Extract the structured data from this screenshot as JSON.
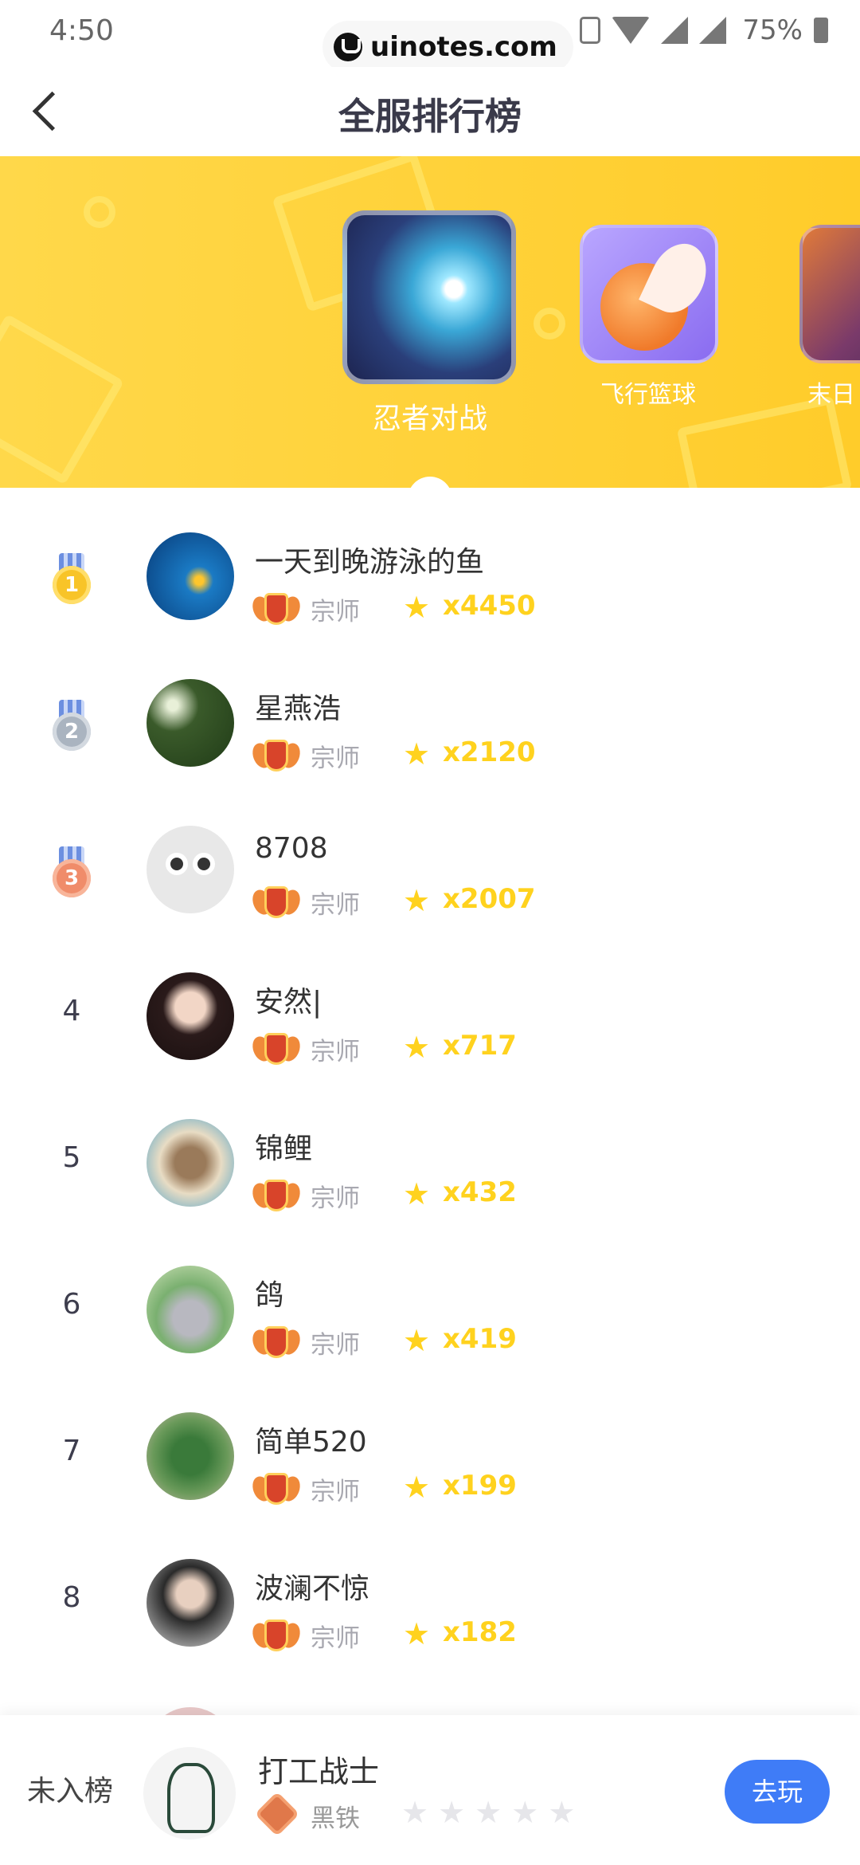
{
  "status_bar": {
    "time": "4:50",
    "watermark": "uinotes.com",
    "battery": "75%"
  },
  "header": {
    "title": "全服排行榜"
  },
  "games": [
    {
      "name": "忍者对战"
    },
    {
      "name": "飞行篮球"
    },
    {
      "name": "末日"
    }
  ],
  "ranking": [
    {
      "rank": "1",
      "name": "一天到晚游泳的鱼",
      "tier": "宗师",
      "score": "x4450"
    },
    {
      "rank": "2",
      "name": "星燕浩",
      "tier": "宗师",
      "score": "x2120"
    },
    {
      "rank": "3",
      "name": "8708",
      "tier": "宗师",
      "score": "x2007"
    },
    {
      "rank": "4",
      "name": "安然|",
      "tier": "宗师",
      "score": "x717"
    },
    {
      "rank": "5",
      "name": "锦鲤",
      "tier": "宗师",
      "score": "x432"
    },
    {
      "rank": "6",
      "name": "鸽",
      "tier": "宗师",
      "score": "x419"
    },
    {
      "rank": "7",
      "name": "简单520",
      "tier": "宗师",
      "score": "x199"
    },
    {
      "rank": "8",
      "name": "波澜不惊",
      "tier": "宗师",
      "score": "x182"
    }
  ],
  "me": {
    "status": "未入榜",
    "name": "打工战士",
    "tier": "黑铁",
    "stars_filled": 0,
    "stars_total": 5,
    "play_label": "去玩"
  },
  "colors": {
    "banner": "#ffd23a",
    "score": "#ffd21e",
    "play_button": "#3f7cf7"
  }
}
